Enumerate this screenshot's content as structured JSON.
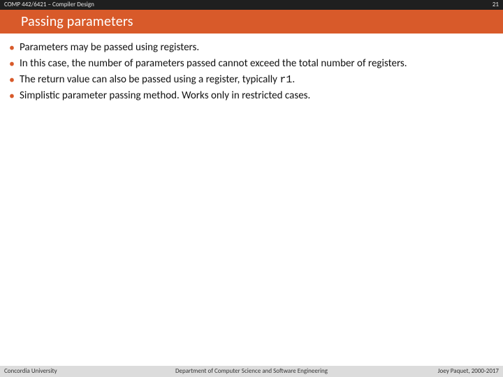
{
  "header": {
    "course": "COMP 442/6421 – Compiler Design",
    "slide_number": "21"
  },
  "title": "Passing parameters",
  "bullets": [
    {
      "text_html": "Parameters may be passed using registers."
    },
    {
      "text_html": "In this case, the number of parameters passed cannot exceed the total number of registers."
    },
    {
      "text_html": "The return value can also be passed using a register, typically <span class=\"code\">r1</span>."
    },
    {
      "text_html": "Simplistic parameter passing method. Works only in restricted cases."
    }
  ],
  "footer": {
    "left": "Concordia University",
    "center": "Department of Computer Science and Software Engineering",
    "right": "Joey Paquet, 2000-2017"
  }
}
